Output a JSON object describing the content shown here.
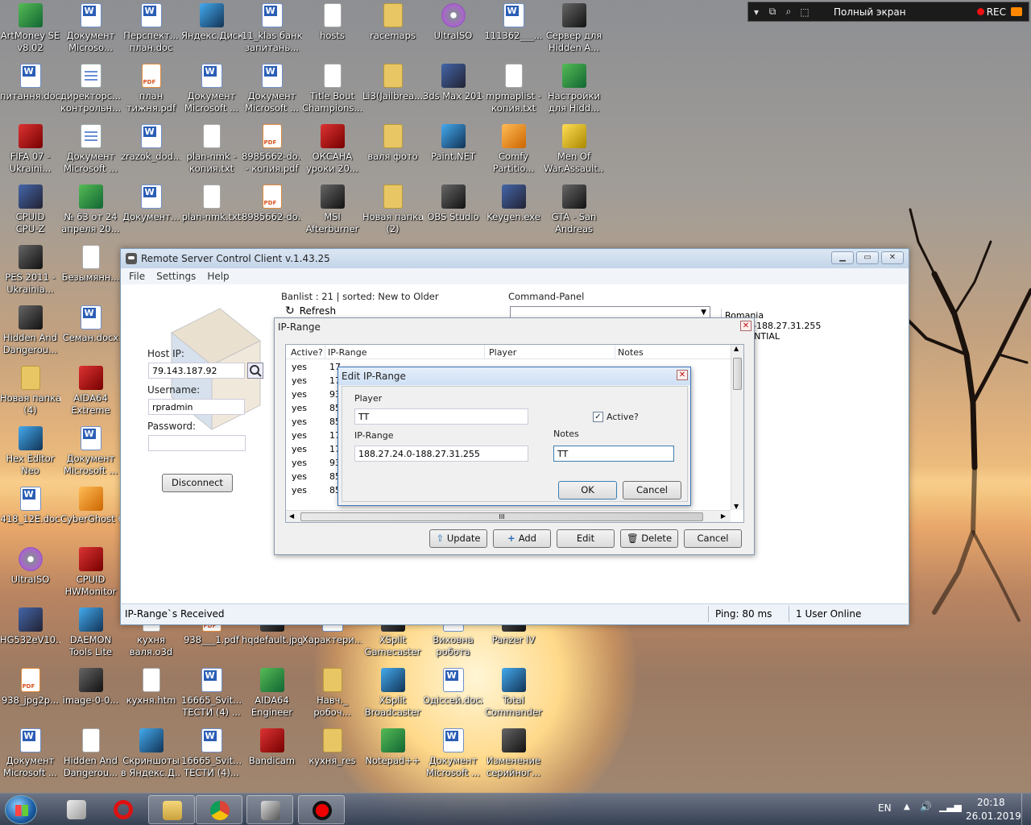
{
  "recorder": {
    "label": "Полный экран",
    "rec": "REC"
  },
  "desktop": [
    {
      "label": "ArtMoney SE\nv8.02",
      "icon": "artmoney-icon",
      "kind": "green"
    },
    {
      "label": "Документ\nMicroso...",
      "icon": "word-doc-icon",
      "kind": "word"
    },
    {
      "label": "Перспект...\nплан.doc",
      "icon": "word-doc-icon",
      "kind": "word"
    },
    {
      "label": "Яндекс.Диск",
      "icon": "yandex-disk-icon",
      "kind": "blue"
    },
    {
      "label": "11_klas банк\nзапитань...",
      "icon": "word-doc-icon",
      "kind": "word"
    },
    {
      "label": "hosts",
      "icon": "file-icon",
      "kind": "txt"
    },
    {
      "label": "racemaps",
      "icon": "folder-icon",
      "kind": "folder"
    },
    {
      "label": "UltraISO",
      "icon": "disc-icon",
      "kind": "disc"
    },
    {
      "label": "111362___...",
      "icon": "word-doc-icon",
      "kind": "word"
    },
    {
      "label": "Сервер для\nHidden A...",
      "icon": "game-icon",
      "kind": "dark"
    },
    {
      "label": "питання.doc",
      "icon": "word-doc-icon",
      "kind": "word"
    },
    {
      "label": "директорс...\nконтрольн...",
      "icon": "doc-icon",
      "kind": "doc"
    },
    {
      "label": "план\nтижня.pdf",
      "icon": "pdf-icon",
      "kind": "pdf"
    },
    {
      "label": "Документ\nMicrosoft ...",
      "icon": "word-doc-icon",
      "kind": "word"
    },
    {
      "label": "Документ\nMicrosoft ...",
      "icon": "word-doc-icon",
      "kind": "word"
    },
    {
      "label": "Title Bout\nChampions...",
      "icon": "shortcut-icon",
      "kind": "txt"
    },
    {
      "label": "Li3(Jailbrea...",
      "icon": "folder-icon",
      "kind": "folder"
    },
    {
      "label": "3ds Max 2014",
      "icon": "3dsmax-icon",
      "kind": "app"
    },
    {
      "label": "mpmaplist -\nкопия.txt",
      "icon": "txt-icon",
      "kind": "txt"
    },
    {
      "label": "Настройки\nдля Hidd...",
      "icon": "arrow-icon",
      "kind": "green"
    },
    {
      "label": "FIFA 07 -\nUkraini...",
      "icon": "fifa-icon",
      "kind": "red"
    },
    {
      "label": "Документ\nMicrosoft ...",
      "icon": "doc-icon",
      "kind": "doc"
    },
    {
      "label": "zrazok_dod...",
      "icon": "word-doc-icon",
      "kind": "word"
    },
    {
      "label": "plan-nmk -\nкопия.txt",
      "icon": "txt-icon",
      "kind": "txt"
    },
    {
      "label": "8985662-do...\n- копия.pdf",
      "icon": "pdf-icon",
      "kind": "pdf"
    },
    {
      "label": "ОКСАНА\nуроки 20...",
      "icon": "winrar-icon",
      "kind": "red"
    },
    {
      "label": "валя фото",
      "icon": "folder-icon",
      "kind": "folder"
    },
    {
      "label": "Paint.NET",
      "icon": "paint-icon",
      "kind": "blue"
    },
    {
      "label": "Comfy\nPartitio...",
      "icon": "partition-icon",
      "kind": "orange"
    },
    {
      "label": "Men Of\nWar.Assault...",
      "icon": "game-icon",
      "kind": "yellow"
    },
    {
      "label": "CPUID\nCPU-Z",
      "icon": "cpuz-icon",
      "kind": "app"
    },
    {
      "label": "№ 63 от 24\nапреля 20...",
      "icon": "excel-icon",
      "kind": "green"
    },
    {
      "label": "Документ...",
      "icon": "word-doc-icon",
      "kind": "word"
    },
    {
      "label": "plan-nmk.txt",
      "icon": "txt-icon",
      "kind": "txt"
    },
    {
      "label": "8985662-do...",
      "icon": "pdf-icon",
      "kind": "pdf"
    },
    {
      "label": "MSI\nAfterburner",
      "icon": "msi-icon",
      "kind": "dark"
    },
    {
      "label": "Новая папка\n(2)",
      "icon": "folder-icon",
      "kind": "folder"
    },
    {
      "label": "OBS Studio",
      "icon": "obs-icon",
      "kind": "dark"
    },
    {
      "label": "Keygen.exe",
      "icon": "keygen-icon",
      "kind": "app"
    },
    {
      "label": "GTA - San\nAndreas",
      "icon": "gta-icon",
      "kind": "dark"
    },
    {
      "label": "PES 2011 -\nUkrainia...",
      "icon": "pes-icon",
      "kind": "dark"
    },
    {
      "label": "Безымянн...",
      "icon": "file-icon",
      "kind": "txt"
    },
    {
      "label": "Hidden And\nDangerou...",
      "icon": "game-icon",
      "kind": "dark"
    },
    {
      "label": "Семан.docx",
      "icon": "word-doc-icon",
      "kind": "word"
    },
    {
      "label": "Новая папка\n(4)",
      "icon": "folder-icon",
      "kind": "folder"
    },
    {
      "label": "AIDA64\nExtreme",
      "icon": "aida64-icon",
      "kind": "red"
    },
    {
      "label": "Hex Editor\nNeo",
      "icon": "hex-icon",
      "kind": "blue"
    },
    {
      "label": "Документ\nMicrosoft ...",
      "icon": "word-doc-icon",
      "kind": "word"
    },
    {
      "label": "418_12E.doc",
      "icon": "word-doc-icon",
      "kind": "word"
    },
    {
      "label": "CyberGhost 6",
      "icon": "cyberghost-icon",
      "kind": "orange"
    },
    {
      "label": "UltraISO",
      "icon": "disc-icon",
      "kind": "disc"
    },
    {
      "label": "CPUID\nHWMonitor",
      "icon": "hwmonitor-icon",
      "kind": "red"
    },
    {
      "label": "HG532eV10...",
      "icon": "winrar-icon",
      "kind": "app"
    },
    {
      "label": "DAEMON\nTools Lite",
      "icon": "daemon-icon",
      "kind": "blue"
    },
    {
      "label": "кухня\nваля.o3d",
      "icon": "file-icon",
      "kind": "txt"
    },
    {
      "label": "938___1.pdf",
      "icon": "pdf-icon",
      "kind": "pdf"
    },
    {
      "label": "hqdefault.jpg",
      "icon": "image-icon",
      "kind": "dark"
    },
    {
      "label": "Характери...",
      "icon": "word-doc-icon",
      "kind": "word"
    },
    {
      "label": "XSplit\nGamecaster",
      "icon": "xsplit-icon",
      "kind": "dark"
    },
    {
      "label": "Виховна\nробота",
      "icon": "word-doc-icon",
      "kind": "word"
    },
    {
      "label": "Panzer IV",
      "icon": "image-icon",
      "kind": "dark"
    },
    {
      "label": "938_jpg2p...",
      "icon": "pdf-icon",
      "kind": "pdf"
    },
    {
      "label": "image-0-0...",
      "icon": "image-icon",
      "kind": "dark"
    },
    {
      "label": "кухня.htm",
      "icon": "file-icon",
      "kind": "txt"
    },
    {
      "label": "16665_Svit...\nТЕСТИ (4) ...",
      "icon": "word-doc-icon",
      "kind": "word"
    },
    {
      "label": "AIDA64\nEngineer",
      "icon": "aida64-icon",
      "kind": "green"
    },
    {
      "label": "Навч._\nробоч...",
      "icon": "folder-icon",
      "kind": "folder"
    },
    {
      "label": "XSplit\nBroadcaster",
      "icon": "xsplit-icon",
      "kind": "blue"
    },
    {
      "label": "Одіссей.docx",
      "icon": "word-doc-icon",
      "kind": "word"
    },
    {
      "label": "Total\nCommander",
      "icon": "totalcmd-icon",
      "kind": "blue"
    },
    {
      "label": "Документ\nMicrosoft ...",
      "icon": "word-doc-icon",
      "kind": "word"
    },
    {
      "label": "Hidden And\nDangerou...",
      "icon": "file-icon",
      "kind": "txt"
    },
    {
      "label": "Скриншоты\nв Яндекс.Д...",
      "icon": "screenshot-icon",
      "kind": "blue"
    },
    {
      "label": "16665_Svit...\nТЕСТИ (4)...",
      "icon": "word-doc-icon",
      "kind": "word"
    },
    {
      "label": "Bandicam",
      "icon": "bandicam-icon",
      "kind": "red"
    },
    {
      "label": "кухня_res",
      "icon": "folder-icon",
      "kind": "folder"
    },
    {
      "label": "Notepad++",
      "icon": "notepad-icon",
      "kind": "green"
    },
    {
      "label": "Документ\nMicrosoft ...",
      "icon": "word-doc-icon",
      "kind": "word"
    },
    {
      "label": "Изменение\nсерийног...",
      "icon": "game-icon",
      "kind": "dark"
    }
  ],
  "main_window": {
    "title": "Remote Server Control Client v.1.43.25",
    "menu": [
      "File",
      "Settings",
      "Help"
    ],
    "host_label": "Host IP:",
    "host_value": "79.143.187.92",
    "user_label": "Username:",
    "user_value": "rpradmin",
    "pass_label": "Password:",
    "pass_value": "",
    "disconnect": "Disconnect",
    "banlist_info": "Banlist : 21  |  sorted: New to Older",
    "refresh": "Refresh",
    "command_panel": "Command-Panel",
    "side_text": [
      "Romania",
      "...24.0-188.27.31.255",
      "...SIDENTIAL"
    ],
    "status": {
      "left": "IP-Range`s Received",
      "ping": "Ping: 80 ms",
      "users": "1 User Online"
    }
  },
  "ip_range_dialog": {
    "title": "IP-Range",
    "columns": [
      "Active?",
      "IP-Range",
      "Player",
      "Notes"
    ],
    "rows": [
      {
        "active": "yes",
        "ip": "17"
      },
      {
        "active": "yes",
        "ip": "17"
      },
      {
        "active": "yes",
        "ip": "93"
      },
      {
        "active": "yes",
        "ip": "85"
      },
      {
        "active": "yes",
        "ip": "85"
      },
      {
        "active": "yes",
        "ip": "17"
      },
      {
        "active": "yes",
        "ip": "17"
      },
      {
        "active": "yes",
        "ip": "93"
      },
      {
        "active": "yes",
        "ip": "85"
      },
      {
        "active": "yes",
        "ip": "85"
      }
    ],
    "buttons": {
      "update": "Update",
      "add": "Add",
      "edit": "Edit",
      "delete": "Delete",
      "cancel": "Cancel"
    },
    "hscroll_grip": "III"
  },
  "edit_dialog": {
    "title": "Edit IP-Range",
    "player_label": "Player",
    "player_value": "TT",
    "active_label": "Active?",
    "active_checked": "✓",
    "ip_label": "IP-Range",
    "ip_value": "188.27.24.0-188.27.31.255",
    "notes_label": "Notes",
    "notes_value": "TT",
    "ok": "OK",
    "cancel": "Cancel"
  },
  "tray": {
    "lang": "EN",
    "time": "20:18",
    "date": "26.01.2019"
  }
}
